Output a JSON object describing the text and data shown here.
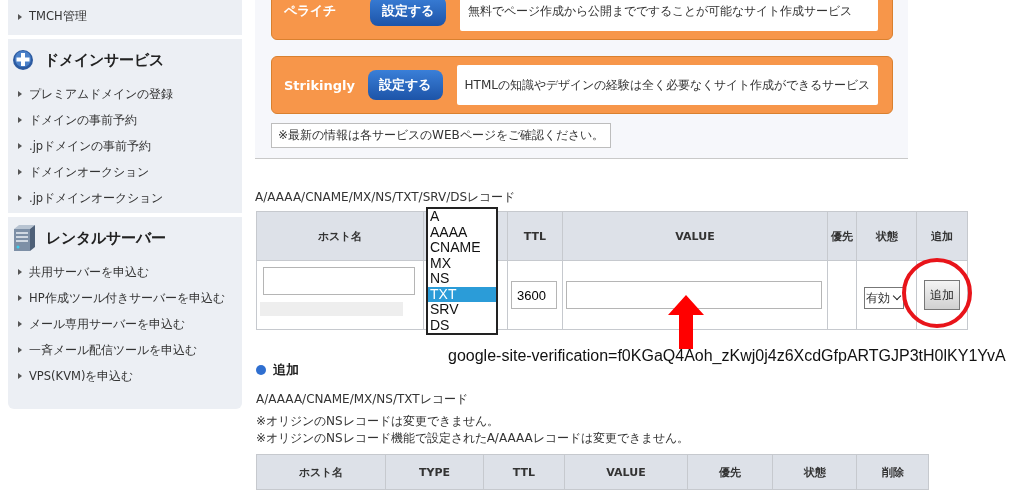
{
  "sidebar": {
    "sections": [
      {
        "items": [
          "TMCH管理"
        ]
      },
      {
        "title": "ドメインサービス",
        "items": [
          "プレミアムドメインの登録",
          "ドメインの事前予約",
          ".jpドメインの事前予約",
          "ドメインオークション",
          ".jpドメインオークション"
        ]
      },
      {
        "title": "レンタルサーバー",
        "items": [
          "共用サーバーを申込む",
          "HP作成ツール付きサーバーを申込む",
          "メール専用サーバーを申込む",
          "一斉メール配信ツールを申込む",
          "VPS(KVM)を申込む"
        ]
      }
    ]
  },
  "services": [
    {
      "name": "ペライチ",
      "button": "設定する",
      "description": "無料でページ作成から公開までですることが可能なサイト作成サービス"
    },
    {
      "name": "Strikingly",
      "button": "設定する",
      "description": "HTMLの知識やデザインの経験は全く必要なくサイト作成ができるサービス"
    }
  ],
  "services_note": "※最新の情報は各サービスのWEBページをご確認ください。",
  "record_form": {
    "label": "A/AAAA/CNAME/MX/NS/TXT/SRV/DSレコード",
    "columns_before_type": [
      "ホスト名"
    ],
    "columns_after_type": [
      "TTL",
      "VALUE",
      "優先",
      "状態",
      "追加"
    ],
    "type_options": [
      {
        "label": "A",
        "selected": false
      },
      {
        "label": "AAAA",
        "selected": false
      },
      {
        "label": "CNAME",
        "selected": false
      },
      {
        "label": "MX",
        "selected": false
      },
      {
        "label": "NS",
        "selected": false
      },
      {
        "label": "TXT",
        "selected": true
      },
      {
        "label": "SRV",
        "selected": false
      },
      {
        "label": "DS",
        "selected": false
      }
    ],
    "ttl": "3600",
    "status": "有効",
    "add_button": "追加"
  },
  "annotation": {
    "text": "google-site-verification=f0KGaQ4Aoh_zKwj0j4z6XcdGfpARTGJP3tH0lKY1YvA"
  },
  "add_section": {
    "title": "追加",
    "label": "A/AAAA/CNAME/MX/NS/TXTレコード",
    "notes": [
      "※オリジンのNSレコードは変更できません。",
      "※オリジンのNSレコード機能で設定されたA/AAAAレコードは変更できません。"
    ],
    "columns": [
      "ホスト名",
      "TYPE",
      "TTL",
      "VALUE",
      "優先",
      "状態",
      "削除"
    ]
  }
}
